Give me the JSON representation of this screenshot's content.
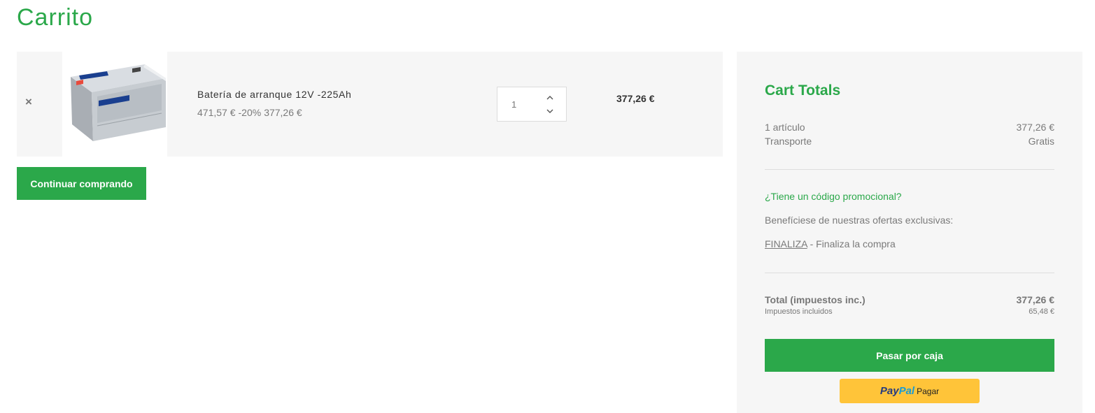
{
  "page": {
    "title": "Carrito"
  },
  "cart": {
    "item": {
      "remove_icon": "×",
      "name": "Batería de arranque 12V -225Ah",
      "regular_price": "471,57 €",
      "discount": "-20%",
      "price": "377,26 €",
      "quantity": "1",
      "line_total": "377,26 €",
      "image": {
        "brand_text": "VARTA"
      }
    },
    "continue_label": "Continuar comprando"
  },
  "totals": {
    "title": "Cart Totals",
    "items_label": "1 artículo",
    "items_value": "377,26 €",
    "shipping_label": "Transporte",
    "shipping_value": "Gratis",
    "promo_link": "¿Tiene un código promocional?",
    "offers_text": "Benefíciese de nuestras ofertas exclusivas:",
    "code": "FINALIZA",
    "code_desc": "- Finaliza la compra",
    "total_label": "Total (impuestos inc.)",
    "total_value": "377,26 €",
    "tax_label": "Impuestos incluidos",
    "tax_value": "65,48 €",
    "checkout_label": "Pasar por caja",
    "paypal": {
      "logo_pay": "Pay",
      "logo_pal": "Pal",
      "label": "Pagar"
    }
  },
  "colors": {
    "accent": "#2ba84a",
    "paypal": "#ffc439",
    "panel_bg": "#f6f6f6"
  }
}
